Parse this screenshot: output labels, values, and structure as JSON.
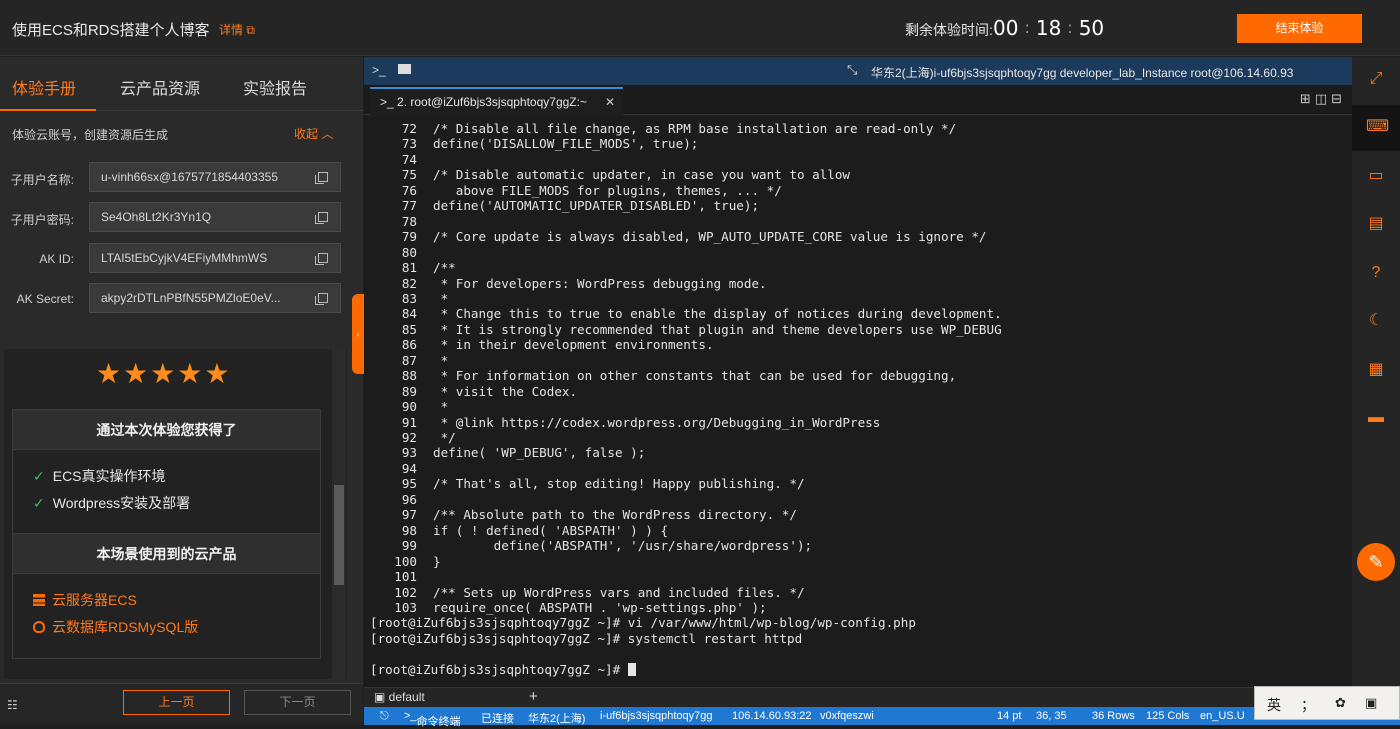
{
  "header": {
    "title": "使用ECS和RDS搭建个人博客",
    "detail_link": "详情",
    "timer_label": "剩余体验时间:",
    "timer": {
      "h": "00",
      "m": "18",
      "s": "50"
    },
    "end_button": "结束体验"
  },
  "left_tabs": [
    "体验手册",
    "云产品资源",
    "实验报告"
  ],
  "account": {
    "header": "体验云账号，创建资源后生成",
    "collapse": "收起",
    "fields": [
      {
        "label": "子用户名称:",
        "value": "u-vinh66sx@1675771854403355"
      },
      {
        "label": "子用户密码:",
        "value": "Se4Oh8Lt2Kr3Yn1Q"
      },
      {
        "label": "AK ID:",
        "value": "LTAI5tEbCyjkV4EFiyMMhmWS"
      },
      {
        "label": "AK Secret:",
        "value": "akpy2rDTLnPBfN55PMZloE0eV..."
      }
    ]
  },
  "guide": {
    "stars": "★★★★★",
    "gained_title": "通过本次体验您获得了",
    "gained_items": [
      "ECS真实操作环境",
      "Wordpress安装及部署"
    ],
    "products_title": "本场景使用到的云产品",
    "products": [
      "云服务器ECS",
      "云数据库RDSMySQL版"
    ]
  },
  "pager": {
    "prev": "上一页",
    "next": "下一页"
  },
  "terminal": {
    "top_info": "华东2(上海)i-uf6bjs3sjsqphtoqy7gg   developer_lab_Instance   root@106.14.60.93",
    "tab_label": "2. root@iZuf6bjs3sjsqphtoqy7ggZ:~",
    "lines": [
      {
        "n": "72",
        "t": "/* Disable all file change, as RPM base installation are read-only */"
      },
      {
        "n": "73",
        "t": "define('DISALLOW_FILE_MODS', true);"
      },
      {
        "n": "74",
        "t": ""
      },
      {
        "n": "75",
        "t": "/* Disable automatic updater, in case you want to allow"
      },
      {
        "n": "76",
        "t": "   above FILE_MODS for plugins, themes, ... */"
      },
      {
        "n": "77",
        "t": "define('AUTOMATIC_UPDATER_DISABLED', true);"
      },
      {
        "n": "78",
        "t": ""
      },
      {
        "n": "79",
        "t": "/* Core update is always disabled, WP_AUTO_UPDATE_CORE value is ignore */"
      },
      {
        "n": "80",
        "t": ""
      },
      {
        "n": "81",
        "t": "/**"
      },
      {
        "n": "82",
        "t": " * For developers: WordPress debugging mode."
      },
      {
        "n": "83",
        "t": " *"
      },
      {
        "n": "84",
        "t": " * Change this to true to enable the display of notices during development."
      },
      {
        "n": "85",
        "t": " * It is strongly recommended that plugin and theme developers use WP_DEBUG"
      },
      {
        "n": "86",
        "t": " * in their development environments."
      },
      {
        "n": "87",
        "t": " *"
      },
      {
        "n": "88",
        "t": " * For information on other constants that can be used for debugging,"
      },
      {
        "n": "89",
        "t": " * visit the Codex."
      },
      {
        "n": "90",
        "t": " *"
      },
      {
        "n": "91",
        "t": " * @link https://codex.wordpress.org/Debugging_in_WordPress"
      },
      {
        "n": "92",
        "t": " */"
      },
      {
        "n": "93",
        "t": "define( 'WP_DEBUG', false );"
      },
      {
        "n": "94",
        "t": ""
      },
      {
        "n": "95",
        "t": "/* That's all, stop editing! Happy publishing. */"
      },
      {
        "n": "96",
        "t": ""
      },
      {
        "n": "97",
        "t": "/** Absolute path to the WordPress directory. */"
      },
      {
        "n": "98",
        "t": "if ( ! defined( 'ABSPATH' ) ) {"
      },
      {
        "n": "99",
        "t": "        define('ABSPATH', '/usr/share/wordpress');"
      },
      {
        "n": "100",
        "t": "}"
      },
      {
        "n": "101",
        "t": ""
      },
      {
        "n": "102",
        "t": "/** Sets up WordPress vars and included files. */"
      },
      {
        "n": "103",
        "t": "require_once( ABSPATH . 'wp-settings.php' );"
      }
    ],
    "shell_lines": [
      "[root@iZuf6bjs3sjsqphtoqy7ggZ ~]# vi /var/www/html/wp-blog/wp-config.php",
      "[root@iZuf6bjs3sjsqphtoqy7ggZ ~]# systemctl restart httpd",
      "",
      "[root@iZuf6bjs3sjsqphtoqy7ggZ ~]# "
    ],
    "session_tab": "default"
  },
  "statusbar": {
    "cmd": "命令终端",
    "connected": "已连接",
    "region": "华东2(上海)",
    "instance": "i-uf6bjs3sjsqphtoqy7gg",
    "ip": "106.14.60.93:22",
    "session": "v0xfqeszwi",
    "font": "14 pt",
    "pos": "36, 35",
    "rows": "36 Rows",
    "cols": "125 Cols",
    "locale": "en_US.U"
  },
  "ime": {
    "lang": "英",
    "punct": "；"
  }
}
